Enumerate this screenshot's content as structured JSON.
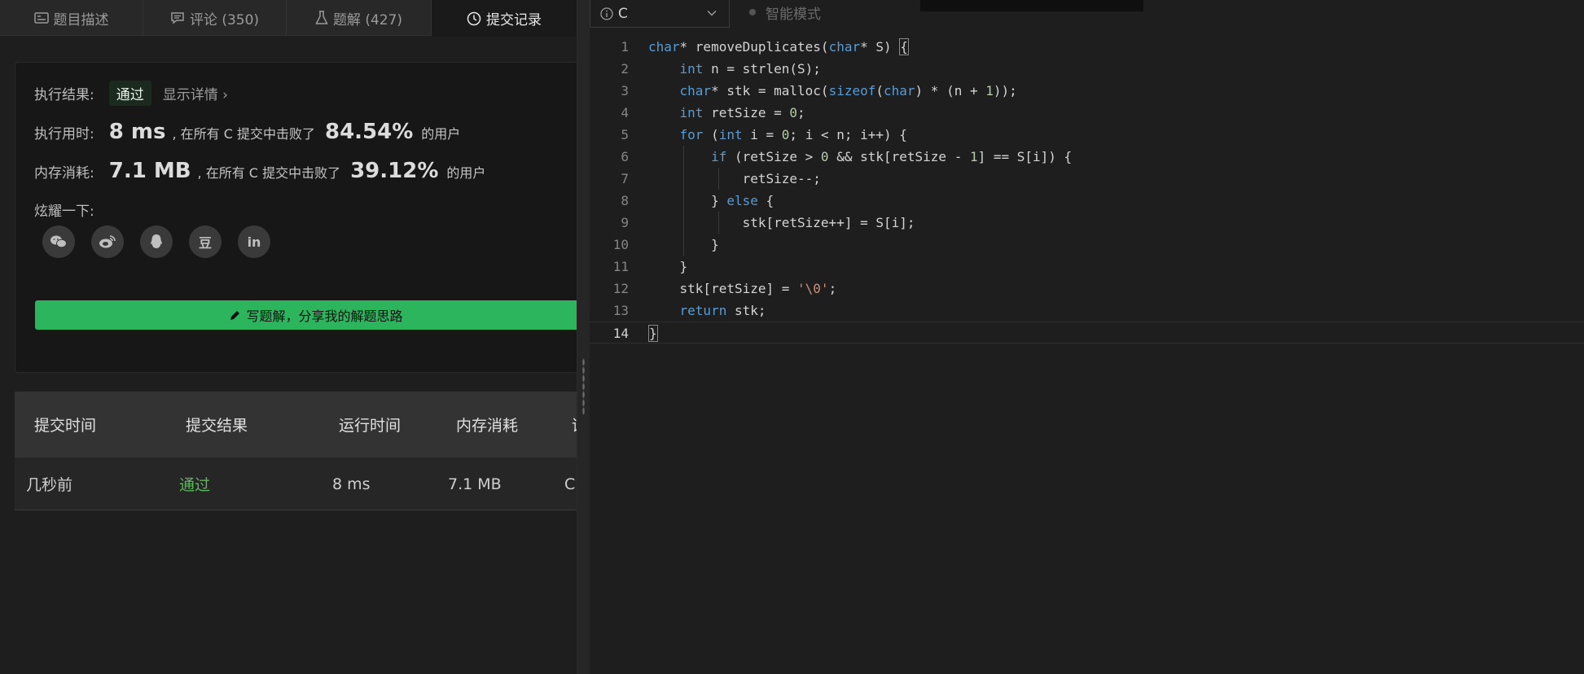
{
  "tabs": [
    {
      "icon": "description-icon",
      "label": "题目描述"
    },
    {
      "icon": "comment-icon",
      "label": "评论 (350)"
    },
    {
      "icon": "flask-icon",
      "label": "题解 (427)"
    },
    {
      "icon": "clock-icon",
      "label": "提交记录"
    }
  ],
  "result": {
    "status_label": "执行结果:",
    "status": "通过",
    "details_link": "显示详情 ›",
    "time_label": "执行用时:",
    "time_value": "8 ms",
    "time_mid": ", 在所有 C 提交中击败了",
    "time_pct": "84.54%",
    "time_suffix": "的用户",
    "mem_label": "内存消耗:",
    "mem_value": "7.1 MB",
    "mem_mid": ", 在所有 C 提交中击败了",
    "mem_pct": "39.12%",
    "mem_suffix": "的用户",
    "share_label": "炫耀一下:",
    "share_icons": [
      {
        "name": "wechat-icon",
        "glyph": "●●"
      },
      {
        "name": "weibo-icon",
        "glyph": "◉"
      },
      {
        "name": "qq-icon",
        "glyph": "♟"
      },
      {
        "name": "douban-icon",
        "glyph": "豆"
      },
      {
        "name": "linkedin-icon",
        "glyph": "in"
      }
    ],
    "write_solution": "写题解，分享我的解题思路"
  },
  "table": {
    "headers": [
      "提交时间",
      "提交结果",
      "运行时间",
      "内存消耗",
      "语"
    ],
    "rows": [
      {
        "time": "几秒前",
        "result": "通过",
        "runtime": "8 ms",
        "memory": "7.1 MB",
        "lang": "C"
      }
    ]
  },
  "editor": {
    "language": "C",
    "mode": "智能模式",
    "lines": [
      "1",
      "2",
      "3",
      "4",
      "5",
      "6",
      "7",
      "8",
      "9",
      "10",
      "11",
      "12",
      "13",
      "14"
    ]
  },
  "colors": {
    "accent_green": "#2db55d",
    "pass_green": "#5cb85c",
    "keyword_blue": "#569cd6"
  }
}
